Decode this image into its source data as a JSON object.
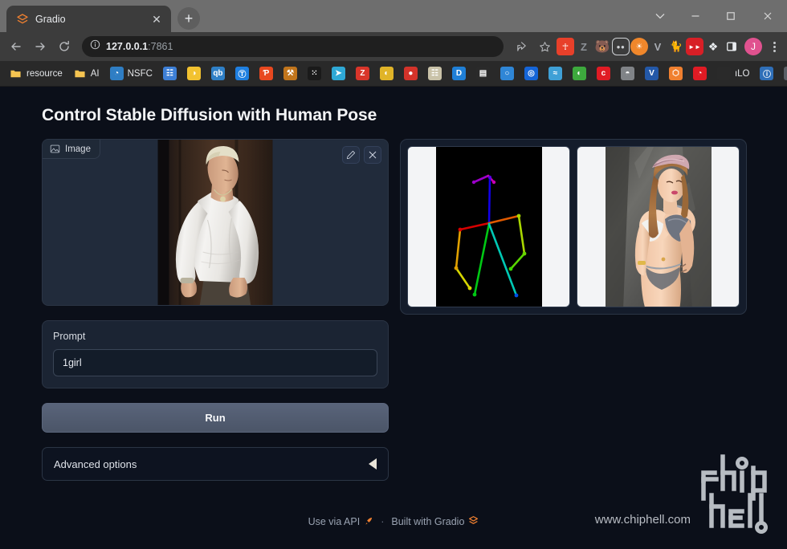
{
  "browser": {
    "tab": {
      "title": "Gradio",
      "favicon_icon": "gradio-logo-icon",
      "close_icon": "close-icon"
    },
    "newtab_icon": "plus-icon",
    "window_controls": [
      {
        "name": "tab-search-button",
        "icon": "chevron-down-icon",
        "glyph": "⌄"
      },
      {
        "name": "minimize-button",
        "icon": "minimize-icon",
        "glyph": "–"
      },
      {
        "name": "maximize-button",
        "icon": "maximize-icon",
        "glyph": "□"
      },
      {
        "name": "close-window-button",
        "icon": "close-icon",
        "glyph": "✕"
      }
    ],
    "nav": {
      "back_icon": "back-arrow-icon",
      "forward_icon": "forward-arrow-icon",
      "reload_icon": "reload-icon",
      "info_icon": "info-circle-icon",
      "url_host": "127.0.0.1",
      "url_port": ":7861",
      "share_icon": "share-icon",
      "bookmark_icon": "star-icon",
      "profile_initial": "J",
      "menu_icon": "kebab-menu-icon"
    },
    "extensions": [
      {
        "name": "extension-metamask",
        "color": "#e8402a",
        "glyph": "✦"
      },
      {
        "name": "extension-zotero",
        "color": "#8d9197",
        "glyph": "Z"
      },
      {
        "name": "extension-firefox-relay",
        "color": "#f08c3a",
        "glyph": "◕"
      },
      {
        "name": "extension-bitwarden",
        "color": "#2b2b2b",
        "glyph": "○○"
      },
      {
        "name": "extension-adblock",
        "color": "#f0872b",
        "glyph": "●"
      },
      {
        "name": "extension-vimium",
        "color": "#a8acb3",
        "glyph": "V"
      },
      {
        "name": "extension-tampermonkey",
        "color": "#f2c230",
        "glyph": "♞"
      },
      {
        "name": "extension-video-downloader",
        "color": "#d81f26",
        "glyph": "▶"
      },
      {
        "name": "extension-puzzle",
        "color": "#e9ecef",
        "glyph": "❖"
      },
      {
        "name": "extension-sidebar",
        "color": "#e9ecef",
        "glyph": "▣"
      }
    ],
    "bookmarks": [
      {
        "name": "bookmark-resource",
        "label": "resource",
        "icon": "folder-icon",
        "color": "#f5c451",
        "glyph": ""
      },
      {
        "name": "bookmark-ai",
        "label": "AI",
        "icon": "folder-icon",
        "color": "#f5c451",
        "glyph": ""
      },
      {
        "name": "bookmark-nsfc",
        "label": "NSFC",
        "icon": "globe-icon",
        "color": "#2f7ec4",
        "glyph": "◔"
      },
      {
        "name": "bookmark-site-1",
        "label": "",
        "icon": "film-icon",
        "color": "#3d7fd6",
        "glyph": "☷"
      },
      {
        "name": "bookmark-site-2",
        "label": "",
        "icon": "bear-icon",
        "color": "#f2c230",
        "glyph": "◑"
      },
      {
        "name": "bookmark-qbittorrent",
        "label": "",
        "icon": "qb-icon",
        "color": "#2f80c7",
        "glyph": "qb"
      },
      {
        "name": "bookmark-site-3",
        "label": "",
        "icon": "circle-t-icon",
        "color": "#1f7fe0",
        "glyph": "Ⓣ"
      },
      {
        "name": "bookmark-site-4",
        "label": "",
        "icon": "pdf-icon",
        "color": "#e8481f",
        "glyph": "Ƥ"
      },
      {
        "name": "bookmark-site-5",
        "label": "",
        "icon": "hammer-icon",
        "color": "#c1751c",
        "glyph": "⚒"
      },
      {
        "name": "bookmark-site-6",
        "label": "",
        "icon": "grid-icon",
        "color": "#1a1a1a",
        "glyph": "⁙"
      },
      {
        "name": "bookmark-site-7",
        "label": "",
        "icon": "bird-icon",
        "color": "#2fa9d6",
        "glyph": "➤"
      },
      {
        "name": "bookmark-site-8",
        "label": "",
        "icon": "z-icon",
        "color": "#d9352a",
        "glyph": "Z"
      },
      {
        "name": "bookmark-site-9",
        "label": "",
        "icon": "leaf-icon",
        "color": "#e0b428",
        "glyph": "◐"
      },
      {
        "name": "bookmark-site-10",
        "label": "",
        "icon": "apple-icon",
        "color": "#d4332a",
        "glyph": "●"
      },
      {
        "name": "bookmark-site-11",
        "label": "",
        "icon": "book-icon",
        "color": "#c9c2a8",
        "glyph": "☷"
      },
      {
        "name": "bookmark-site-12",
        "label": "",
        "icon": "d-icon",
        "color": "#1f7fd6",
        "glyph": "D"
      },
      {
        "name": "bookmark-site-13",
        "label": "",
        "icon": "phone-icon",
        "color": "#2a2a2a",
        "glyph": "▤"
      },
      {
        "name": "bookmark-site-14",
        "label": "",
        "icon": "ring-icon",
        "color": "#2f86d6",
        "glyph": "○"
      },
      {
        "name": "bookmark-site-15",
        "label": "",
        "icon": "circle-blue-icon",
        "color": "#1565d8",
        "glyph": "◎"
      },
      {
        "name": "bookmark-site-16",
        "label": "",
        "icon": "wave-icon",
        "color": "#3fa0d6",
        "glyph": "≈"
      },
      {
        "name": "bookmark-site-17",
        "label": "",
        "icon": "green-leaf-icon",
        "color": "#3da93d",
        "glyph": "◐"
      },
      {
        "name": "bookmark-site-18",
        "label": "",
        "icon": "c-icon",
        "color": "#e01b24",
        "glyph": "c"
      },
      {
        "name": "bookmark-site-19",
        "label": "",
        "icon": "globe-gray-icon",
        "color": "#808387",
        "glyph": "◓"
      },
      {
        "name": "bookmark-site-20",
        "label": "",
        "icon": "v-icon",
        "color": "#2358a8",
        "glyph": "V"
      },
      {
        "name": "bookmark-site-21",
        "label": "",
        "icon": "gradio-icon",
        "color": "#f08030",
        "glyph": "⬡"
      },
      {
        "name": "bookmark-site-22",
        "label": "",
        "icon": "red-tag-icon",
        "color": "#e01b24",
        "glyph": "◔"
      },
      {
        "name": "bookmark-site-23",
        "label": "ıLO",
        "icon": "ilo-icon",
        "color": "#2a2a2a",
        "glyph": ""
      },
      {
        "name": "bookmark-site-24",
        "label": "",
        "icon": "clock-icon",
        "color": "#2f6fb8",
        "glyph": "ⓘ"
      },
      {
        "name": "bookmark-site-25",
        "label": "",
        "icon": "cn-icon",
        "color": "#5a5f66",
        "glyph": "日"
      }
    ],
    "bookmarks_overflow_icon": "chevron-double-right-icon",
    "bookmarks_overflow_glyph": "»"
  },
  "app": {
    "title": "Control Stable Diffusion with Human Pose",
    "image_input": {
      "badge_label": "Image",
      "badge_icon": "image-icon",
      "edit_icon": "pencil-icon",
      "clear_icon": "close-icon",
      "alt": "photo of a man in white long-sleeve shirt"
    },
    "prompt": {
      "label": "Prompt",
      "value": "1girl",
      "placeholder": ""
    },
    "run_button": {
      "label": "Run"
    },
    "advanced": {
      "label": "Advanced options",
      "toggle_icon": "caret-left-icon",
      "expanded": false
    },
    "gallery": {
      "items": [
        {
          "name": "gallery-item-pose",
          "alt": "openpose skeleton on black background"
        },
        {
          "name": "gallery-item-result",
          "alt": "generated image of a woman against rock wall"
        }
      ]
    },
    "footer": {
      "api_label": "Use via API",
      "api_icon": "rocket-icon",
      "separator": "·",
      "built_label": "Built with Gradio",
      "gradio_icon": "gradio-logo-icon"
    },
    "watermark": {
      "text": "www.chiphell.com",
      "logo_icon": "chiphell-logo-icon"
    }
  },
  "colors": {
    "page_background": "#0b0f19",
    "panel": "#1b2433",
    "panel_border": "#2b3545",
    "accent_orange": "#f08030",
    "text_primary": "#f3f4f6",
    "text_muted": "#9aa3b2",
    "profile": "#e0528f"
  }
}
